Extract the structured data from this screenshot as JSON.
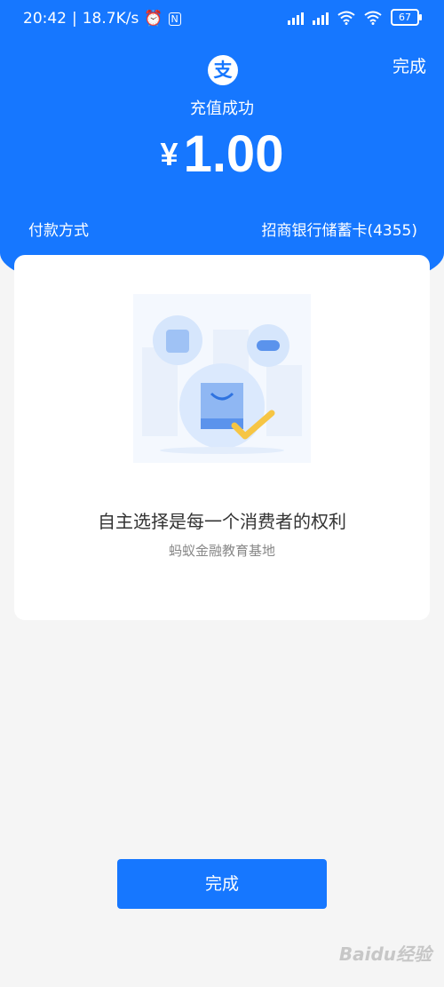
{
  "status_bar": {
    "time": "20:42",
    "net_speed": "18.7K/s",
    "battery": "67"
  },
  "header": {
    "done_label": "完成",
    "logo_glyph": "支",
    "title": "充值成功",
    "currency": "¥",
    "amount": "1.00",
    "payment_label": "付款方式",
    "payment_value": "招商银行储蓄卡(4355)"
  },
  "card": {
    "slogan": "自主选择是每一个消费者的权利",
    "subtitle": "蚂蚁金融教育基地"
  },
  "footer": {
    "done_button_label": "完成"
  },
  "watermark": "Baidu经验",
  "colors": {
    "brand": "#1677ff",
    "check": "#f6c544"
  }
}
